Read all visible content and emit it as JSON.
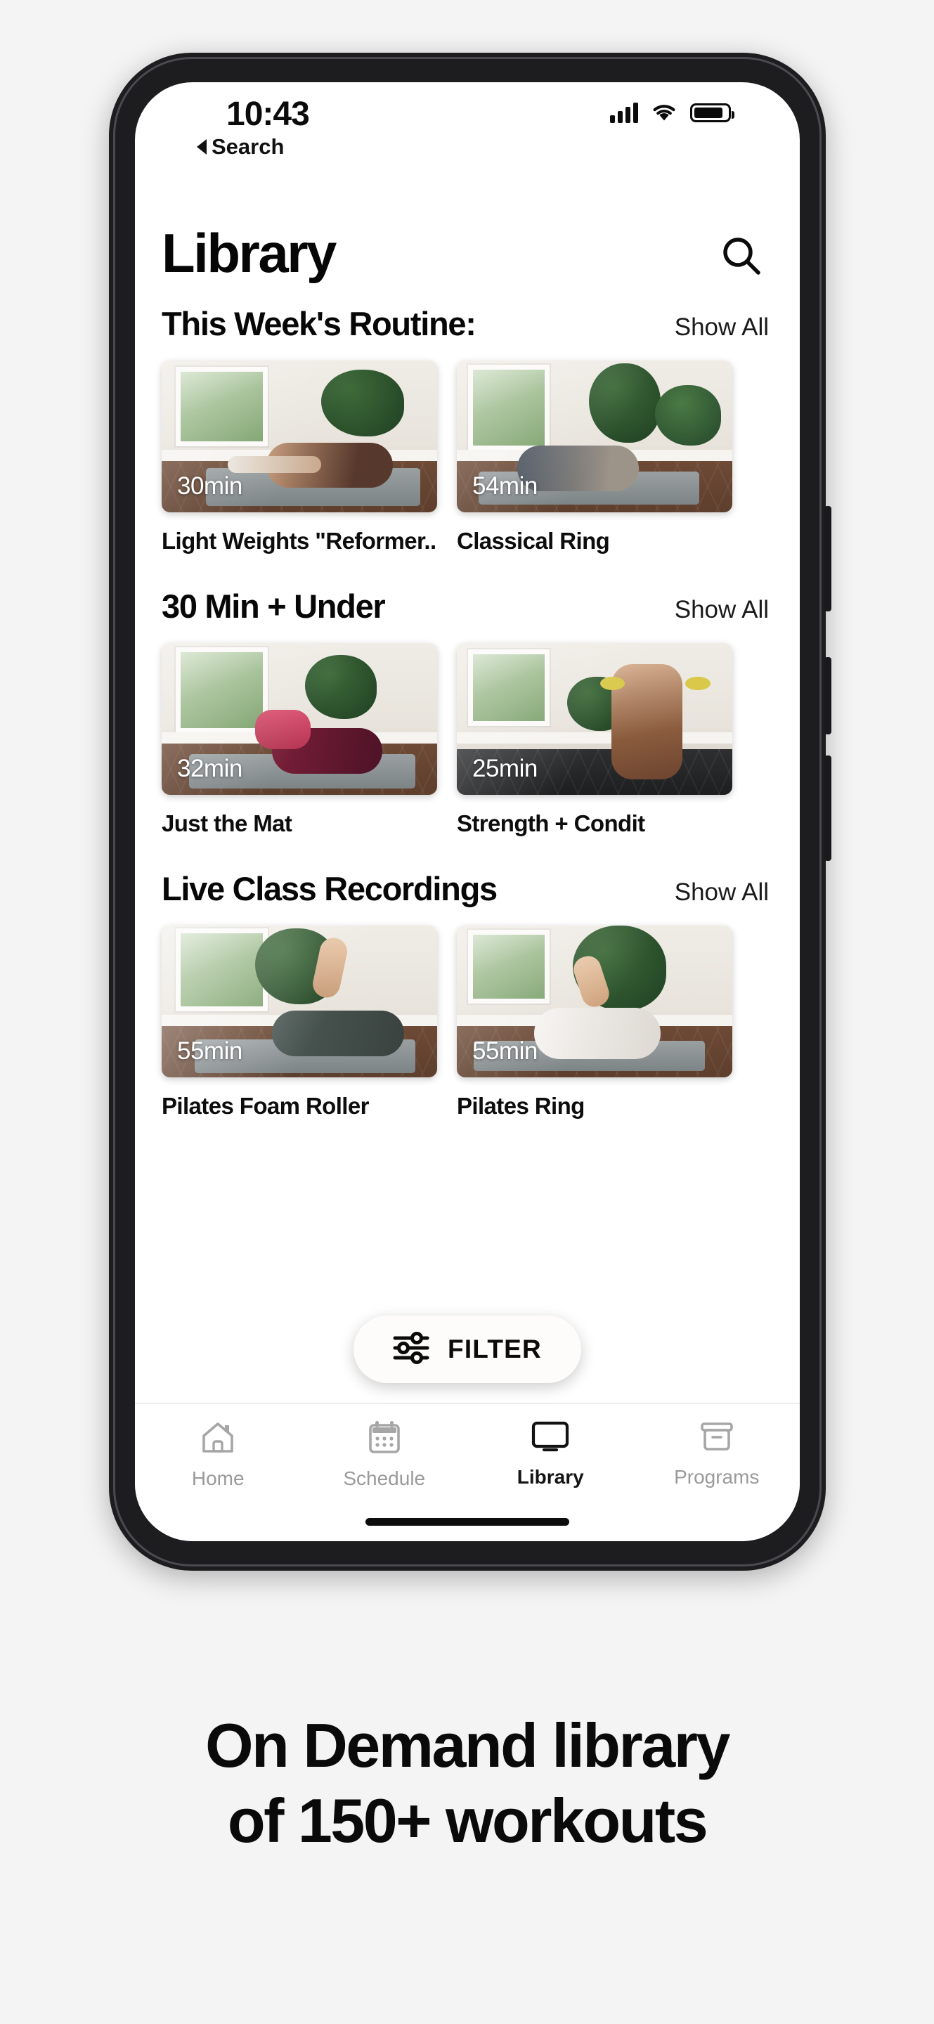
{
  "status_bar": {
    "time": "10:43",
    "back_label": "Search",
    "icons": [
      "cellular-signal-icon",
      "wifi-icon",
      "battery-icon"
    ]
  },
  "header": {
    "title": "Library",
    "search_icon": "search-icon"
  },
  "sections": [
    {
      "title": "This Week's Routine:",
      "show_all": "Show All",
      "cards": [
        {
          "duration": "30min",
          "title": "Light Weights \"Reformer..."
        },
        {
          "duration": "54min",
          "title": "Classical Ring"
        }
      ]
    },
    {
      "title": "30 Min + Under",
      "show_all": "Show All",
      "cards": [
        {
          "duration": "32min",
          "title": "Just the Mat"
        },
        {
          "duration": "25min",
          "title": "Strength + Condit"
        }
      ]
    },
    {
      "title": "Live Class Recordings",
      "show_all": "Show All",
      "cards": [
        {
          "duration": "55min",
          "title": "Pilates Foam Roller"
        },
        {
          "duration": "55min",
          "title": "Pilates Ring"
        }
      ]
    }
  ],
  "filter_button": {
    "label": "FILTER",
    "icon": "sliders-icon"
  },
  "tab_bar": {
    "items": [
      {
        "label": "Home",
        "icon": "home-icon",
        "active": false
      },
      {
        "label": "Schedule",
        "icon": "calendar-icon",
        "active": false
      },
      {
        "label": "Library",
        "icon": "monitor-icon",
        "active": true
      },
      {
        "label": "Programs",
        "icon": "archive-icon",
        "active": false
      }
    ]
  },
  "caption": {
    "line1": "On Demand library",
    "line2": "of 150+ workouts"
  },
  "colors": {
    "background": "#f4f4f4",
    "screen": "#ffffff",
    "text": "#0a0a0a",
    "muted": "#9a9a9a",
    "frame": "#1d1d1f"
  }
}
